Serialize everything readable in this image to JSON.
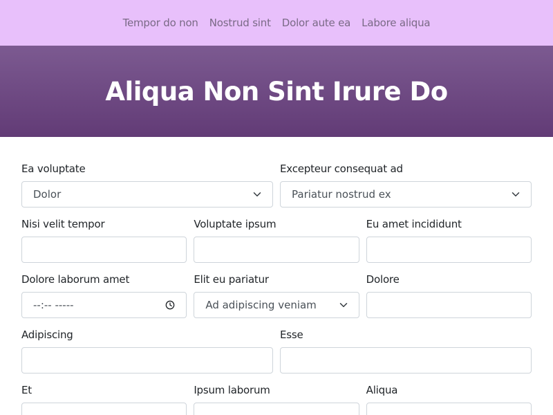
{
  "nav": {
    "links": [
      "Tempor do non",
      "Nostrud sint",
      "Dolor aute ea",
      "Labore aliqua"
    ]
  },
  "hero": {
    "title": "Aliqua Non Sint Irure Do"
  },
  "form": {
    "row1": [
      {
        "label": "Ea voluptate",
        "value": "Dolor"
      },
      {
        "label": "Excepteur consequat ad",
        "value": "Pariatur nostrud ex"
      }
    ],
    "row2": [
      {
        "label": "Nisi velit tempor",
        "value": ""
      },
      {
        "label": "Voluptate ipsum",
        "value": ""
      },
      {
        "label": "Eu amet incididunt",
        "value": ""
      }
    ],
    "row3": [
      {
        "label": "Dolore laborum amet",
        "value": "--:-- -----"
      },
      {
        "label": "Elit eu pariatur",
        "value": "Ad adipiscing veniam"
      },
      {
        "label": "Dolore",
        "value": ""
      }
    ],
    "row4": [
      {
        "label": "Adipiscing",
        "value": ""
      },
      {
        "label": "Esse",
        "value": ""
      }
    ],
    "row5": [
      {
        "label": "Et"
      },
      {
        "label": "Ipsum laborum"
      },
      {
        "label": "Aliqua"
      }
    ]
  },
  "colors": {
    "nav_bg": "#e8c0fb",
    "hero_top": "#7c5a91",
    "hero_bottom": "#623b76",
    "border": "#ced4da"
  },
  "icons": {
    "select": "chevron-down-icon",
    "time": "clock-icon"
  }
}
